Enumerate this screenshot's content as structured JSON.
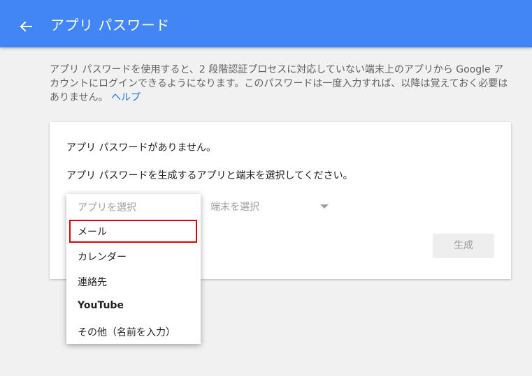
{
  "header": {
    "title": "アプリ パスワード",
    "back_icon": "arrow-back-icon",
    "background_color": "#4285f4"
  },
  "intro": {
    "text": "アプリ パスワードを使用すると、2 段階認証プロセスに対応していない端末上のアプリから Google アカウントにログインできるようになります。このパスワードは一度入力すれば、以降は覚えておく必要はありません。",
    "help_link": "ヘルプ",
    "link_color": "#1a73e8"
  },
  "card": {
    "no_passwords_text": "アプリ パスワードがありません。",
    "instruction_text": "アプリ パスワードを生成するアプリと端末を選択してください。",
    "device_select_placeholder": "端末を選択",
    "generate_button": "生成"
  },
  "app_dropdown": {
    "placeholder": "アプリを選択",
    "options": [
      "メール",
      "カレンダー",
      "連絡先",
      "YouTube",
      "その他（名前を入力）"
    ],
    "highlighted_option": "メール",
    "highlight_color": "#e30000"
  }
}
